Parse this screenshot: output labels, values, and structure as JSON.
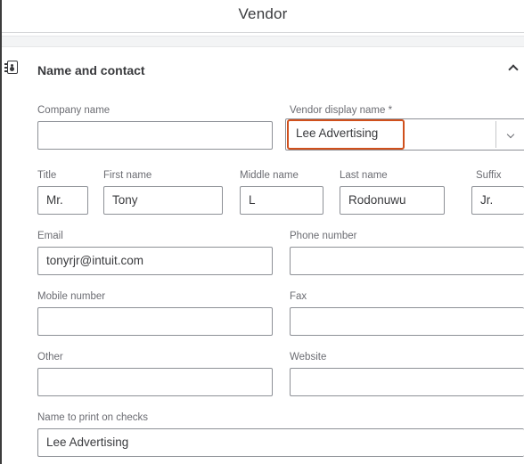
{
  "header": {
    "title": "Vendor"
  },
  "section": {
    "title": "Name and contact"
  },
  "fields": {
    "company_name": {
      "label": "Company name",
      "value": ""
    },
    "vendor_display_name": {
      "label": "Vendor display name *",
      "value": "Lee Advertising"
    },
    "title": {
      "label": "Title",
      "value": "Mr."
    },
    "first_name": {
      "label": "First name",
      "value": "Tony"
    },
    "middle_name": {
      "label": "Middle name",
      "value": "L"
    },
    "last_name": {
      "label": "Last name",
      "value": "Rodonuwu"
    },
    "suffix": {
      "label": "Suffix",
      "value": "Jr."
    },
    "email": {
      "label": "Email",
      "value": "tonyrjr@intuit.com"
    },
    "phone": {
      "label": "Phone number",
      "value": ""
    },
    "mobile": {
      "label": "Mobile number",
      "value": ""
    },
    "fax": {
      "label": "Fax",
      "value": ""
    },
    "other": {
      "label": "Other",
      "value": ""
    },
    "website": {
      "label": "Website",
      "value": ""
    },
    "print_name": {
      "label": "Name to print on checks",
      "value": "Lee Advertising"
    }
  },
  "colors": {
    "focus": "#d0501c",
    "border": "#8d9096",
    "label": "#6b6c72",
    "text": "#393a3d"
  },
  "icons": {
    "section": "contact-card-icon",
    "collapse": "chevron-up-icon",
    "dropdown": "chevron-down-icon"
  }
}
